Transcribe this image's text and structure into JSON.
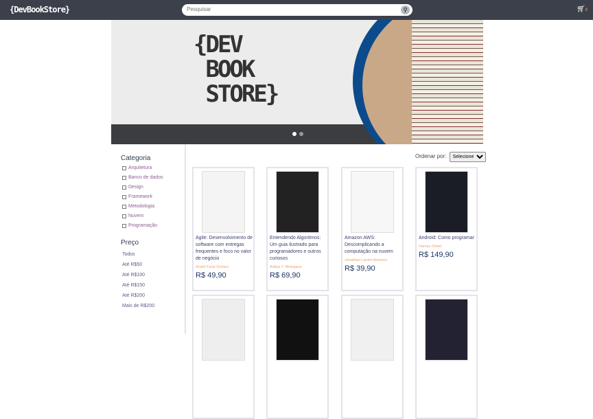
{
  "header": {
    "logo": "{DevBookStore}",
    "search_placeholder": "Pesquisar",
    "cart_count": "0"
  },
  "banner": {
    "title": "{DEV BOOK STORE}",
    "slides": 2,
    "active_slide": 1
  },
  "sidebar": {
    "category_title": "Categoria",
    "categories": [
      "Arquitetura",
      "Banco de dados",
      "Design",
      "Framework",
      "Metodologia",
      "Nuvem",
      "Programação"
    ],
    "price_title": "Preço",
    "prices": [
      "Todos",
      "Até R$50",
      "Até R$100",
      "Até R$150",
      "Até R$200",
      "Mais de R$200"
    ]
  },
  "sort": {
    "label": "Ordenar por:",
    "selected": "Selecione"
  },
  "products": [
    {
      "title": "Agile: Desenvolvimento de software com entregas frequentes e foco no valor de negócio",
      "author": "André Faria Gomes",
      "price": "R$ 49,90",
      "cover_color": "#f4f4f4"
    },
    {
      "title": "Entendendo Algoritmos: Um guia ilustrado para programadores e outros curiosos",
      "author": "Aditya Y. Bhargava",
      "price": "R$ 69,90",
      "cover_color": "#222222"
    },
    {
      "title": "Amazon AWS: Descomplicando a computação na nuvem",
      "author": "Jonathan Lamim Antunes",
      "price": "R$ 39,90",
      "cover_color": "#f7f7f7"
    },
    {
      "title": "Android: Como programar",
      "author": "Harvey Deitel",
      "price": "R$ 149,90",
      "cover_color": "#1b1d26"
    },
    {
      "cover_color": "#eeeeee"
    },
    {
      "cover_color": "#111111"
    },
    {
      "cover_color": "#f0f0f0"
    },
    {
      "cover_color": "#222233"
    }
  ]
}
